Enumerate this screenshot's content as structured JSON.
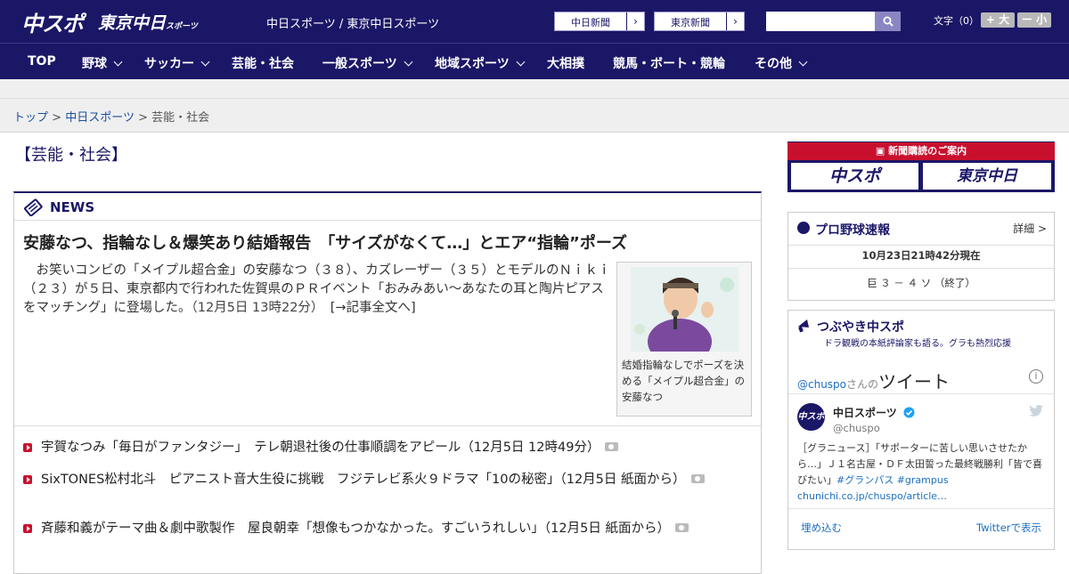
{
  "header": {
    "logo_chuspo": "中スポ",
    "logo_tokyo": "東京中日",
    "logo_tokyo_small": "スポーツ",
    "site_names": "中日スポーツ / 東京中日スポーツ",
    "link_chunichi": "中日新聞",
    "link_tokyo": "東京新聞",
    "search_placeholder": "",
    "font_size_label": "文字（0）",
    "font_bigger": "+ 大",
    "font_smaller": "ー 小"
  },
  "nav": {
    "items": [
      "TOP",
      "野球",
      "サッカー",
      "芸能・社会",
      "一般スポーツ",
      "地域スポーツ",
      "大相撲",
      "競馬・ボート・競輪",
      "その他"
    ]
  },
  "breadcrumb": {
    "top": "トップ",
    "sep": ">",
    "section": "中日スポーツ",
    "current": "芸能・社会"
  },
  "page_title": "【芸能・社会】",
  "news": {
    "heading": "NEWS",
    "headline": "安藤なつ、指輪なし＆爆笑あり結婚報告　「サイズがなくて…」とエア“指輪”ポーズ",
    "lead": "お笑いコンビの「メイプル超合金」の安藤なつ（３８）、カズレーザー（３５）とモデルのＮｉｋｉ（２３）が５日、東京都内で行われた佐賀県のＰＲイベント「おみみあい～あなたの耳と陶片ピアスをマッチング」に登場した。",
    "lead_time": "（12月5日 13時22分）",
    "read_more": "[→記事全文へ]",
    "photo_caption": "結婚指輪なしでポーズを決める「メイプル超合金」の安藤なつ",
    "items": [
      {
        "title": "宇賀なつみ「毎日がファンタジー」　テレ朝退社後の仕事順調をアピール",
        "time": "（12月5日 12時49分）"
      },
      {
        "title": "SixTONES松村北斗　ピアニスト音大生役に挑戦　フジテレビ系火９ドラマ「10の秘密」",
        "time": "（12月5日 紙面から）"
      },
      {
        "title": "斉藤和義がテーマ曲＆劇中歌製作　屋良朝幸「想像もつかなかった。すごいうれしい」",
        "time": "（12月5日 紙面から）"
      }
    ]
  },
  "sidebar": {
    "banner_title": "新聞購読のご案内",
    "banner_chuspo": "中スポ",
    "banner_tokyo": "東京中日",
    "baseball": {
      "title": "プロ野球速報",
      "more": "詳細 >",
      "updated": "10月23日21時42分現在",
      "score": "巨 ３ － ４ ソ （終了）"
    },
    "tweets": {
      "title": "つぶやき中スポ",
      "subtitle": "ドラ観戦の本紙評論家も語る。グラも熱烈応援",
      "account_prefix": "@chuspo",
      "account_suffix": "さんの",
      "tweets_word": "ツイート",
      "user_name": "中日スポーツ",
      "user_handle": "@chuspo",
      "avatar_text": "中スポ",
      "tweet_text": "［グラニュース］「サポーターに苦しい思いさせたから…」Ｊ１名古屋・ＤＦ太田誓った最終戦勝利「皆で喜びたい」",
      "tweet_hashtags": "#グランパス #grampus",
      "tweet_link": "chunichi.co.jp/chuspo/article…",
      "embed": "埋め込む",
      "view_on_twitter": "Twitterで表示"
    }
  },
  "colors": {
    "brand_navy": "#1b1767",
    "accent_red": "#c8102e",
    "link_blue": "#1b4fa0"
  }
}
